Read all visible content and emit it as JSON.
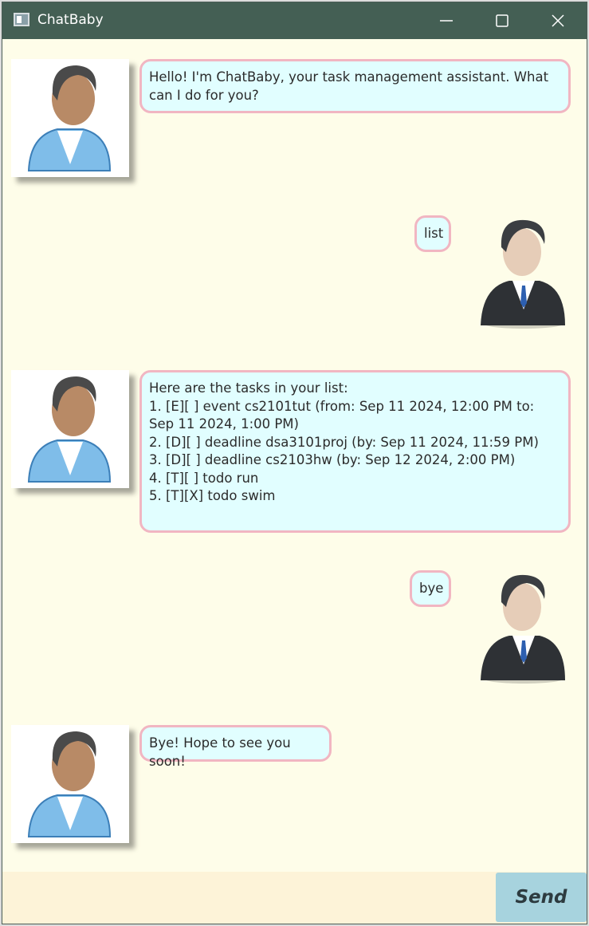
{
  "window": {
    "title": "ChatBaby",
    "icon": "app-window-icon",
    "controls": [
      "minimize-icon",
      "maximize-icon",
      "close-icon"
    ]
  },
  "messages": [
    {
      "sender": "bot",
      "avatar": "bot-avatar",
      "text": "Hello! I'm ChatBaby, your task management assistant. What can I do for you?"
    },
    {
      "sender": "user",
      "avatar": "user-avatar",
      "text": "list"
    },
    {
      "sender": "bot",
      "avatar": "bot-avatar",
      "text": "Here are the tasks in your list:\n1. [E][ ] event cs2101tut (from: Sep 11 2024, 12:00 PM to: Sep 11 2024, 1:00 PM)\n2. [D][ ] deadline dsa3101proj (by: Sep 11 2024, 11:59 PM)\n3. [D][ ] deadline cs2103hw (by: Sep 12 2024, 2:00 PM)\n4. [T][ ] todo run\n5. [T][X] todo swim"
    },
    {
      "sender": "user",
      "avatar": "user-avatar",
      "text": "bye"
    },
    {
      "sender": "bot",
      "avatar": "bot-avatar",
      "text": "Bye! Hope to see you soon!"
    }
  ],
  "input": {
    "value": "",
    "placeholder": ""
  },
  "send_label": "Send",
  "colors": {
    "titlebar": "#445f54",
    "background": "#fefde9",
    "bubble_fill": "#e1feff",
    "bubble_border": "#f1b6c2",
    "input_bg": "#fdf3d8",
    "send_button": "#a7d3de"
  }
}
